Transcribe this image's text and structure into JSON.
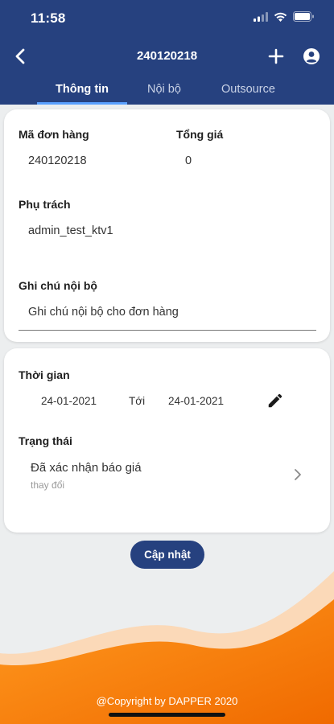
{
  "status_bar": {
    "time": "11:58"
  },
  "header": {
    "title": "240120218",
    "tabs": [
      {
        "label": "Thông tin",
        "active": true
      },
      {
        "label": "Nội bộ",
        "active": false
      },
      {
        "label": "Outsource",
        "active": false
      }
    ]
  },
  "info_card": {
    "order_code_label": "Mã đơn hàng",
    "order_code": "240120218",
    "total_label": "Tổng giá",
    "total": "0",
    "assignee_label": "Phụ trách",
    "assignee": "admin_test_ktv1",
    "internal_note_label": "Ghi chú nội bộ",
    "internal_note": "Ghi chú nội bộ cho đơn hàng"
  },
  "time_card": {
    "time_label": "Thời gian",
    "start_date": "24-01-2021",
    "to_label": "Tới",
    "end_date": "24-01-2021",
    "status_label": "Trạng thái",
    "status_value": "Đã xác nhận báo giá",
    "status_change": "thay đổi"
  },
  "update_button": "Cập nhật",
  "footer": {
    "copyright": "@Copyright by DAPPER 2020"
  },
  "colors": {
    "primary": "#26417f",
    "accent": "#f57c00",
    "background": "#eceeef"
  },
  "icons": [
    "back-arrow-icon",
    "plus-icon",
    "account-circle-icon",
    "pencil-icon",
    "chevron-right-icon",
    "signal-icon",
    "wifi-icon",
    "battery-icon"
  ]
}
